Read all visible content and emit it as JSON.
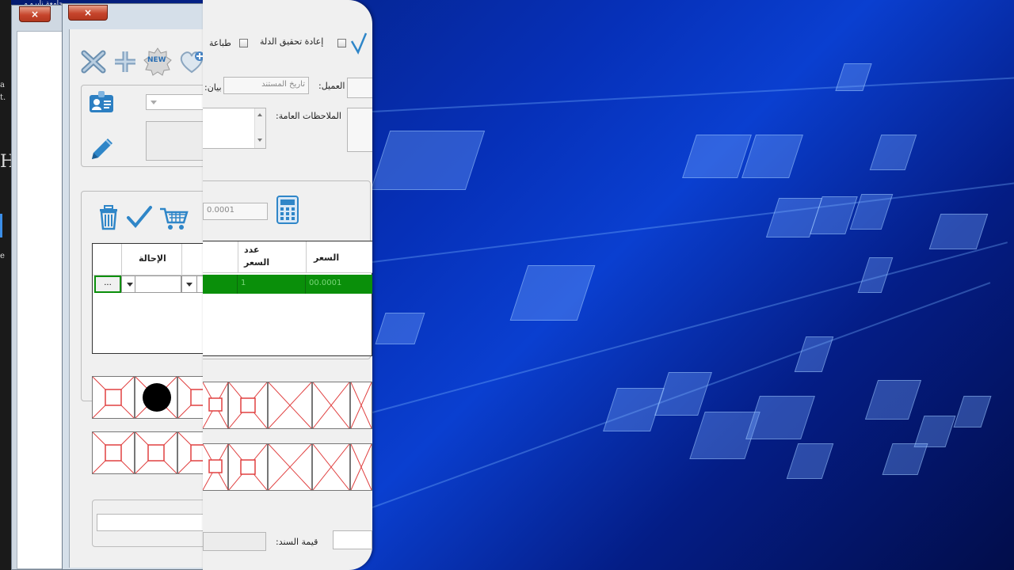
{
  "desktop": {
    "top_caption": "جامعة نايرو و",
    "left_letters": [
      "a",
      "t.",
      "H",
      "e"
    ]
  },
  "windows": {
    "close_symbol": "×"
  },
  "toolbar": {
    "new_badge": "NEW",
    "checkbox1_label": "إعادة تحقيق الدلة",
    "checkbox2_label": "طباعة"
  },
  "form": {
    "field_label_1": "العميل:",
    "field_label_2": "بيان:",
    "field_placeholder_2": "تاريخ المستند",
    "notes_label": "الملاحظات العامة:",
    "amount_value": "0.0001"
  },
  "grid": {
    "header_col_transfer": "الإحالة",
    "header_col_quantity_1": "عدد",
    "header_col_quantity_2": "السعر",
    "header_col_price": "السعر",
    "row_button": "...",
    "row_qty": "1",
    "row_price": "00.0001"
  },
  "footer": {
    "total_label": "قيمة السند:"
  }
}
